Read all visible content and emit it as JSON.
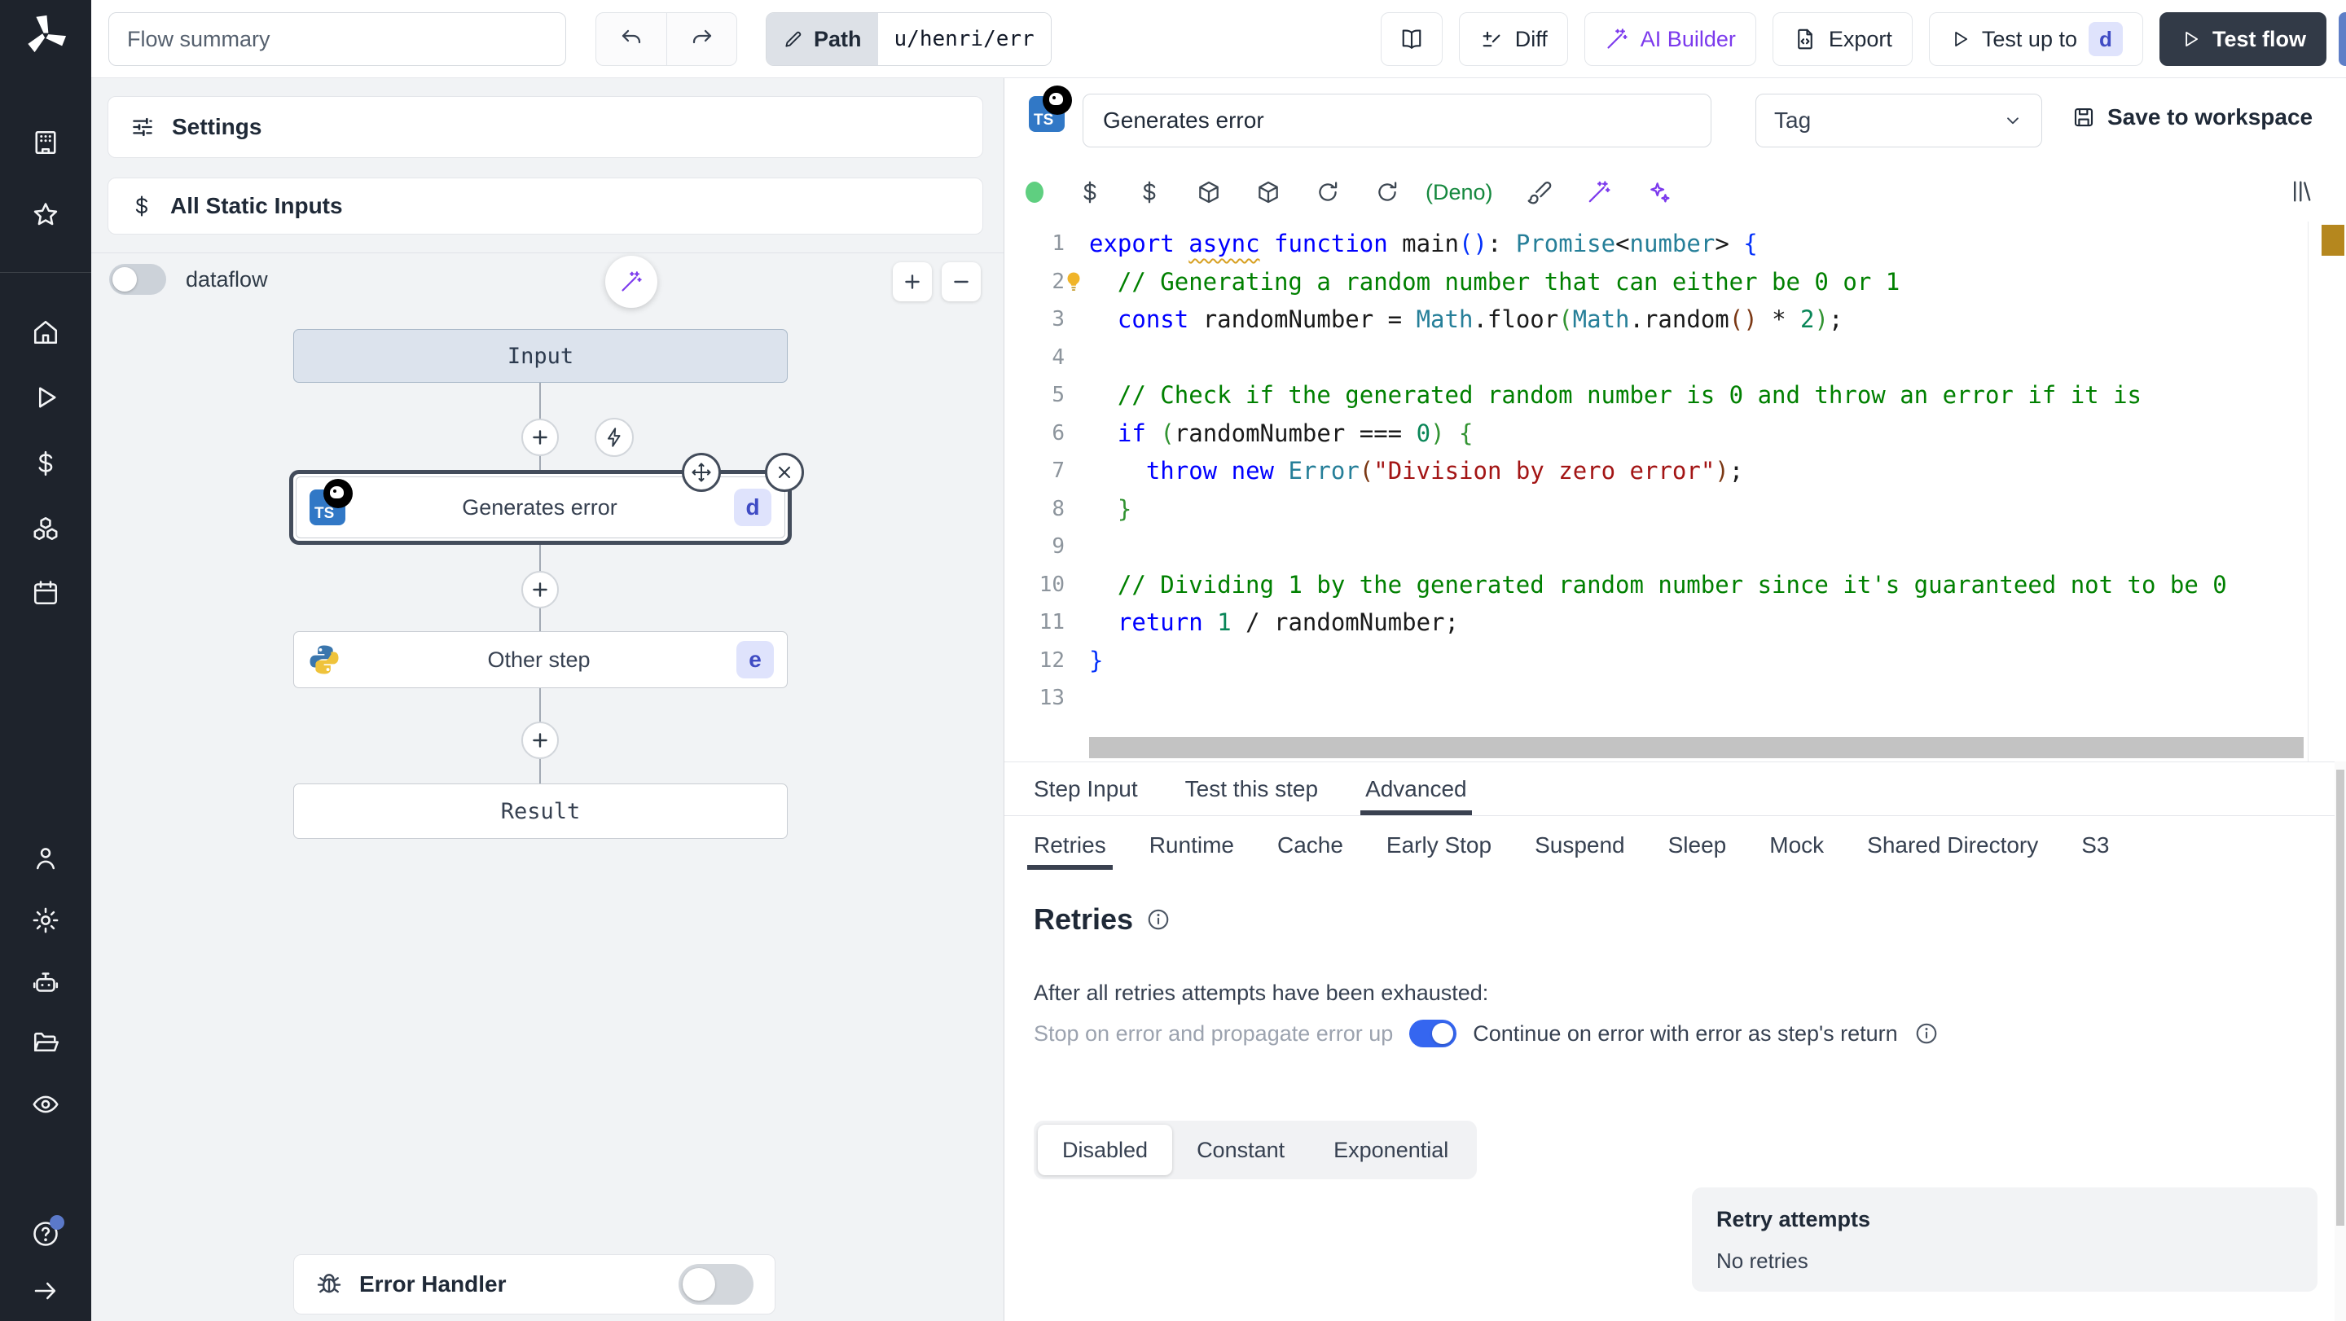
{
  "topbar": {
    "flow_summary_placeholder": "Flow summary",
    "path_label": "Path",
    "path_value": "u/henri/err",
    "diff_label": "Diff",
    "ai_builder_label": "AI Builder",
    "export_label": "Export",
    "test_up_to_label": "Test up to",
    "test_up_to_badge": "d",
    "test_flow_label": "Test flow"
  },
  "sidebar": {
    "icons": [
      "building",
      "star",
      "home",
      "play",
      "dollar",
      "cubes",
      "calendar",
      "person",
      "gear",
      "robot",
      "folder",
      "eye",
      "help",
      "arrow-right"
    ]
  },
  "flow": {
    "settings_label": "Settings",
    "static_inputs_label": "All Static Inputs",
    "dataflow_label": "dataflow",
    "input_node_label": "Input",
    "step1_label": "Generates error",
    "step1_badge": "d",
    "step2_label": "Other step",
    "step2_badge": "e",
    "result_node_label": "Result",
    "error_handler_label": "Error Handler"
  },
  "editor": {
    "step_name": "Generates error",
    "tag_placeholder": "Tag",
    "save_label": "Save to workspace",
    "runtime_label": "(Deno)",
    "toolbar_icons": [
      "status-dot",
      "dollar",
      "dollar",
      "package",
      "package",
      "refresh",
      "refresh",
      "deno-label",
      "brush",
      "wand",
      "sparkles"
    ],
    "code_lines": [
      {
        "n": 1,
        "segs": [
          [
            "k",
            "export"
          ],
          [
            "p",
            " "
          ],
          [
            "ku",
            "async"
          ],
          [
            "p",
            " "
          ],
          [
            "k",
            "function"
          ],
          [
            "p",
            " "
          ],
          [
            "p",
            "main"
          ],
          [
            "b1",
            "()"
          ],
          [
            "p",
            ": "
          ],
          [
            "t",
            "Promise"
          ],
          [
            "p",
            "<"
          ],
          [
            "t",
            "number"
          ],
          [
            "p",
            "> "
          ],
          [
            "b1",
            "{"
          ]
        ]
      },
      {
        "n": 2,
        "bulb": true,
        "segs": [
          [
            "p",
            "  "
          ],
          [
            "c",
            "// Generating a random number that can either be 0 or 1"
          ]
        ]
      },
      {
        "n": 3,
        "segs": [
          [
            "p",
            "  "
          ],
          [
            "k",
            "const"
          ],
          [
            "p",
            " randomNumber = "
          ],
          [
            "t",
            "Math"
          ],
          [
            "p",
            ".floor"
          ],
          [
            "b2",
            "("
          ],
          [
            "t",
            "Math"
          ],
          [
            "p",
            ".random"
          ],
          [
            "b3",
            "()"
          ],
          [
            "p",
            " * "
          ],
          [
            "n",
            "2"
          ],
          [
            "b2",
            ")"
          ],
          [
            "p",
            ";"
          ]
        ]
      },
      {
        "n": 4,
        "segs": []
      },
      {
        "n": 5,
        "segs": [
          [
            "p",
            "  "
          ],
          [
            "c",
            "// Check if the generated random number is 0 and throw an error if it is"
          ]
        ]
      },
      {
        "n": 6,
        "segs": [
          [
            "p",
            "  "
          ],
          [
            "k",
            "if"
          ],
          [
            "p",
            " "
          ],
          [
            "b2",
            "("
          ],
          [
            "p",
            "randomNumber === "
          ],
          [
            "n",
            "0"
          ],
          [
            "b2",
            ")"
          ],
          [
            "p",
            " "
          ],
          [
            "b2",
            "{"
          ]
        ]
      },
      {
        "n": 7,
        "segs": [
          [
            "p",
            "    "
          ],
          [
            "k",
            "throw"
          ],
          [
            "p",
            " "
          ],
          [
            "k",
            "new"
          ],
          [
            "p",
            " "
          ],
          [
            "t",
            "Error"
          ],
          [
            "b3",
            "("
          ],
          [
            "s",
            "\"Division by zero error\""
          ],
          [
            "b3",
            ")"
          ],
          [
            "p",
            ";"
          ]
        ]
      },
      {
        "n": 8,
        "segs": [
          [
            "p",
            "  "
          ],
          [
            "b2",
            "}"
          ]
        ]
      },
      {
        "n": 9,
        "segs": []
      },
      {
        "n": 10,
        "segs": [
          [
            "p",
            "  "
          ],
          [
            "c",
            "// Dividing 1 by the generated random number since it's guaranteed not to be 0"
          ]
        ]
      },
      {
        "n": 11,
        "segs": [
          [
            "p",
            "  "
          ],
          [
            "k",
            "return"
          ],
          [
            "p",
            " "
          ],
          [
            "n",
            "1"
          ],
          [
            "p",
            " / randomNumber;"
          ]
        ]
      },
      {
        "n": 12,
        "segs": [
          [
            "b1",
            "}"
          ]
        ]
      },
      {
        "n": 13,
        "segs": []
      }
    ]
  },
  "panel": {
    "tabs": [
      "Step Input",
      "Test this step",
      "Advanced"
    ],
    "active_tab": "Advanced",
    "subtabs": [
      "Retries",
      "Runtime",
      "Cache",
      "Early Stop",
      "Suspend",
      "Sleep",
      "Mock",
      "Shared Directory",
      "S3"
    ],
    "active_subtab": "Retries",
    "retries": {
      "heading": "Retries",
      "exhausted_text": "After all retries attempts have been exhausted:",
      "stop_label": "Stop on error and propagate error up",
      "continue_label": "Continue on error with error as step's return",
      "modes": [
        "Disabled",
        "Constant",
        "Exponential"
      ],
      "active_mode": "Disabled",
      "retry_attempts_label": "Retry attempts",
      "retry_attempts_value": "No retries"
    }
  },
  "colors": {
    "accent_purple": "#7c3aed",
    "deno_green": "#15883e",
    "status_green": "#5fcf80",
    "toggle_blue": "#3566f0",
    "badge_bg": "#dfe3fc",
    "badge_text": "#3f4bc4",
    "ts_blue": "#3178c6",
    "selected_ring": "#434c5b",
    "marker_gold": "#b5871e",
    "sidebar_bg": "#1e232c",
    "dark_button": "#323a47"
  }
}
